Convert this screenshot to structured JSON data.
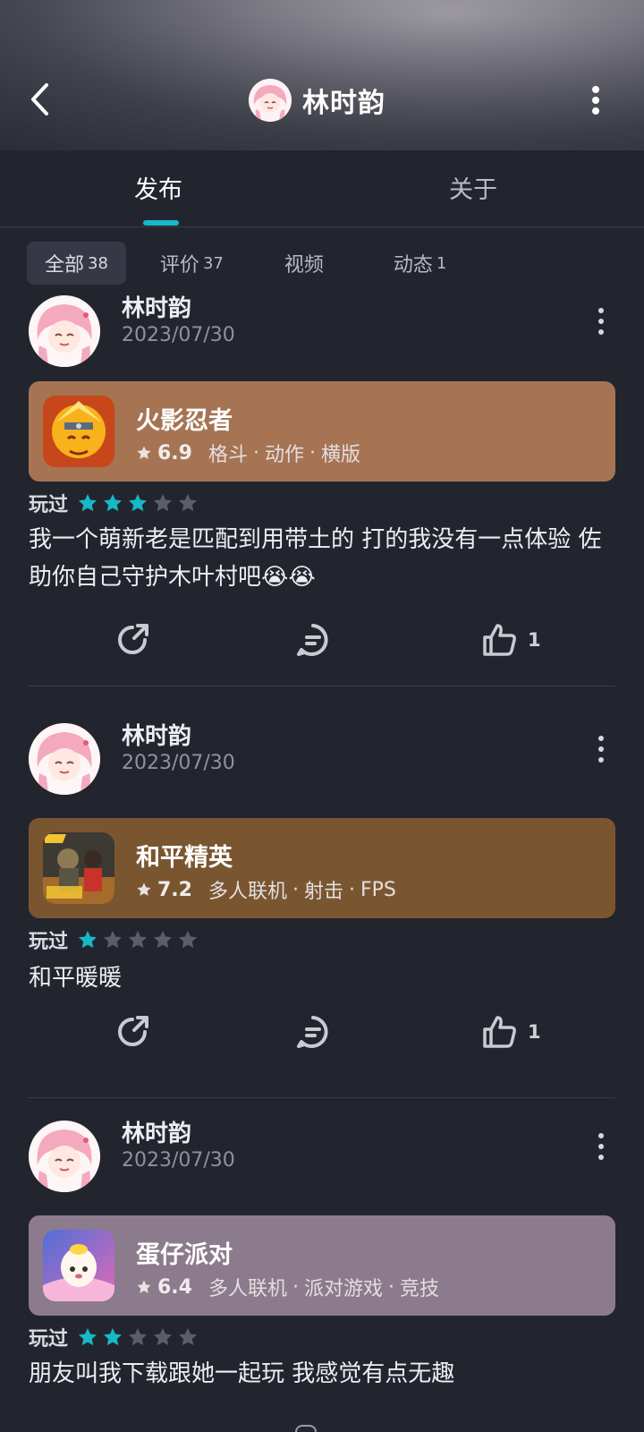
{
  "header": {
    "title": "林时韵",
    "colors": {
      "accent": "#17b8c8",
      "background": "#23252e"
    }
  },
  "tabs": [
    {
      "label": "发布",
      "active": true
    },
    {
      "label": "关于",
      "active": false
    }
  ],
  "filters": [
    {
      "label": "全部",
      "count": "38",
      "active": true
    },
    {
      "label": "评价",
      "count": "37",
      "active": false
    },
    {
      "label": "视频",
      "count": "",
      "active": false
    },
    {
      "label": "动态",
      "count": "1",
      "active": false
    }
  ],
  "posts": [
    {
      "user": "林时韵",
      "date": "2023/07/30",
      "game": {
        "name": "火影忍者",
        "score": "6.9",
        "tags": [
          "格斗",
          "动作",
          "横版"
        ],
        "card_color": "#a67453"
      },
      "played_label": "玩过",
      "rating": 3,
      "review": "我一个萌新老是匹配到用带土的 打的我没有一点体验 佐助你自己守护木叶村吧😭😭",
      "likes": "1"
    },
    {
      "user": "林时韵",
      "date": "2023/07/30",
      "game": {
        "name": "和平精英",
        "score": "7.2",
        "tags": [
          "多人联机",
          "射击",
          "FPS"
        ],
        "card_color": "#7a5630"
      },
      "played_label": "玩过",
      "rating": 1,
      "review": "和平暖暖",
      "likes": "1"
    },
    {
      "user": "林时韵",
      "date": "2023/07/30",
      "game": {
        "name": "蛋仔派对",
        "score": "6.4",
        "tags": [
          "多人联机",
          "派对游戏",
          "竞技"
        ],
        "card_color": "#8c7b8d"
      },
      "played_label": "玩过",
      "rating": 2,
      "review": "朋友叫我下载跟她一起玩 我感觉有点无趣",
      "likes": ""
    }
  ]
}
